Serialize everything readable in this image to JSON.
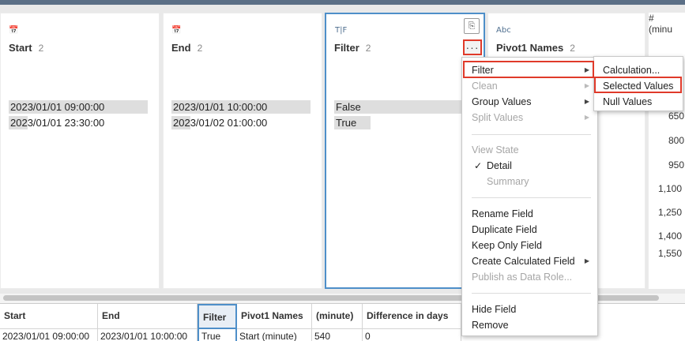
{
  "profile": {
    "cards": [
      {
        "type_icon": "calendar-clock-icon",
        "type_glyph": "📅",
        "name": "Start",
        "count": "2",
        "values": [
          "2023/01/01 09:00:00",
          "2023/01/01 23:30:00"
        ],
        "bar_fractions": [
          1.0,
          0.14
        ]
      },
      {
        "type_icon": "calendar-clock-icon",
        "type_glyph": "📅",
        "name": "End",
        "count": "2",
        "values": [
          "2023/01/01 10:00:00",
          "2023/01/02 01:00:00"
        ],
        "bar_fractions": [
          1.0,
          0.14
        ]
      },
      {
        "type_icon": "boolean-icon",
        "type_glyph": "T|F",
        "name": "Filter",
        "count": "2",
        "values": [
          "False",
          "True"
        ],
        "bar_fractions": [
          1.0,
          0.26
        ]
      },
      {
        "type_icon": "string-icon",
        "type_glyph": "Abc",
        "name": "Pivot1 Names",
        "count": "2"
      },
      {
        "type_icon": "number-icon",
        "type_glyph": "#",
        "name": "(minu",
        "values": [
          "650",
          "800",
          "950",
          "1,100",
          "1,250",
          "1,400",
          "1,550"
        ]
      }
    ],
    "more_button_glyph": "···"
  },
  "context_menu": {
    "items": [
      {
        "label": "Filter",
        "submenu": true,
        "disabled": false
      },
      {
        "label": "Clean",
        "submenu": true,
        "disabled": true
      },
      {
        "label": "Group Values",
        "submenu": true,
        "disabled": false
      },
      {
        "label": "Split Values",
        "submenu": true,
        "disabled": true
      },
      {
        "label": "View State",
        "section": true
      },
      {
        "label": "Detail",
        "checked": true
      },
      {
        "label": "Summary",
        "disabled": true
      },
      {
        "label": "Rename Field"
      },
      {
        "label": "Duplicate Field"
      },
      {
        "label": "Keep Only Field"
      },
      {
        "label": "Create Calculated Field",
        "submenu": true
      },
      {
        "label": "Publish as Data Role...",
        "disabled": true
      },
      {
        "label": "Hide Field"
      },
      {
        "label": "Remove"
      }
    ],
    "check_glyph": "✓",
    "arrow_glyph": "▶"
  },
  "filter_submenu": {
    "items": [
      "Calculation...",
      "Selected Values",
      "Null Values"
    ]
  },
  "grid": {
    "headers": [
      "Start",
      "End",
      "Filter",
      "Pivot1 Names",
      "(minute)",
      "Difference in days"
    ],
    "row": [
      "2023/01/01 09:00:00",
      "2023/01/01 10:00:00",
      "True",
      "Start (minute)",
      "540",
      "0"
    ]
  },
  "colors": {
    "accent": "#4e8fc9",
    "highlight": "#e03a2a",
    "topbar": "#5b6f86"
  }
}
